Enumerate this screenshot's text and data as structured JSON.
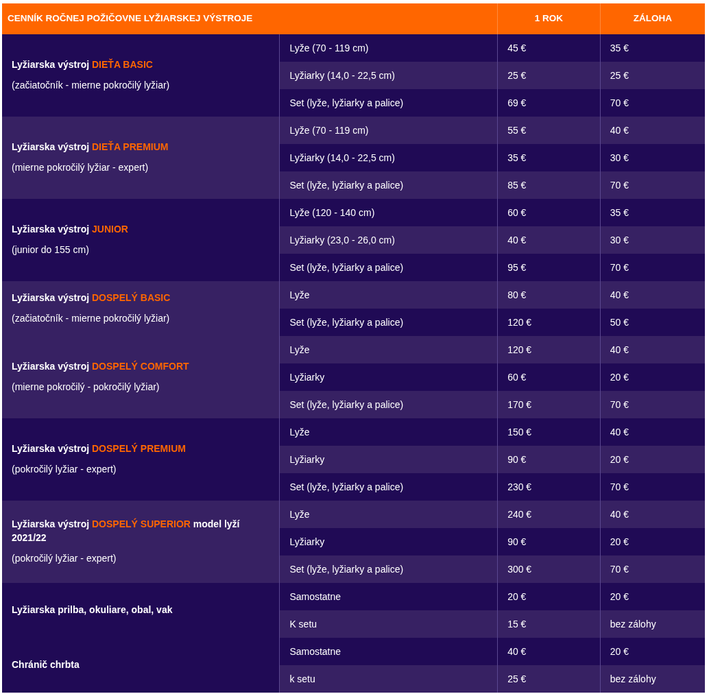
{
  "table": {
    "columns": [
      "CENNÍK ROČNEJ POŽIČOVNE LYŽIARSKEJ VÝSTROJE",
      "1 ROK",
      "ZÁLOHA"
    ],
    "groups": [
      {
        "title": [
          {
            "kind": "plain",
            "text": "Lyžiarska výstroj "
          },
          {
            "kind": "accent",
            "text": "DIEŤA BASIC"
          }
        ],
        "subtitle": "(začiatočník - mierne pokročilý lyžiar)",
        "items": [
          {
            "label": "Lyže (70 - 119 cm)",
            "price": "45 €",
            "deposit": "35 €"
          },
          {
            "label": "Lyžiarky (14,0 - 22,5 cm)",
            "price": "25 €",
            "deposit": "25 €"
          },
          {
            "label": "Set (lyže, lyžiarky a palice)",
            "price": "69 €",
            "deposit": "70 €"
          }
        ]
      },
      {
        "title": [
          {
            "kind": "plain",
            "text": "Lyžiarska výstroj "
          },
          {
            "kind": "accent",
            "text": "DIEŤA PREMIUM"
          }
        ],
        "subtitle": "(mierne pokročilý lyžiar - expert)",
        "items": [
          {
            "label": "Lyže (70 - 119 cm)",
            "price": "55 €",
            "deposit": "40 €"
          },
          {
            "label": "Lyžiarky (14,0 - 22,5 cm)",
            "price": "35 €",
            "deposit": "30 €"
          },
          {
            "label": "Set (lyže, lyžiarky a palice)",
            "price": "85 €",
            "deposit": "70 €"
          }
        ]
      },
      {
        "title": [
          {
            "kind": "plain",
            "text": "Lyžiarska výstroj "
          },
          {
            "kind": "accent",
            "text": "JUNIOR"
          }
        ],
        "subtitle": "(junior do 155 cm)",
        "items": [
          {
            "label": "Lyže (120 - 140 cm)",
            "price": "60 €",
            "deposit": "35 €"
          },
          {
            "label": "Lyžiarky (23,0 - 26,0 cm)",
            "price": "40 €",
            "deposit": "30 €"
          },
          {
            "label": "Set (lyže, lyžiarky a palice)",
            "price": "95 €",
            "deposit": "70 €"
          }
        ]
      },
      {
        "title": [
          {
            "kind": "plain",
            "text": "Lyžiarska výstroj "
          },
          {
            "kind": "accent",
            "text": "DOSPELÝ BASIC"
          }
        ],
        "subtitle": "(začiatočník - mierne pokročilý lyžiar)",
        "items": [
          {
            "label": "Lyže",
            "price": "80 €",
            "deposit": "40 €"
          },
          {
            "label": "Set (lyže, lyžiarky a palice)",
            "price": "120 €",
            "deposit": "50 €"
          }
        ]
      },
      {
        "title": [
          {
            "kind": "plain",
            "text": "Lyžiarska výstroj "
          },
          {
            "kind": "accent",
            "text": "DOSPELÝ COMFORT"
          }
        ],
        "subtitle": "(mierne pokročilý - pokročilý lyžiar)",
        "items": [
          {
            "label": "Lyže",
            "price": "120 €",
            "deposit": "40 €"
          },
          {
            "label": "Lyžiarky",
            "price": "60 €",
            "deposit": "20 €"
          },
          {
            "label": "Set (lyže, lyžiarky a palice)",
            "price": "170 €",
            "deposit": "70 €"
          }
        ]
      },
      {
        "title": [
          {
            "kind": "plain",
            "text": "Lyžiarska výstroj "
          },
          {
            "kind": "accent",
            "text": "DOSPELÝ PREMIUM"
          }
        ],
        "subtitle": "(pokročilý lyžiar - expert)",
        "items": [
          {
            "label": "Lyže",
            "price": "150 €",
            "deposit": "40 €"
          },
          {
            "label": "Lyžiarky",
            "price": "90 €",
            "deposit": "20 €"
          },
          {
            "label": "Set (lyže, lyžiarky a palice)",
            "price": "230 €",
            "deposit": "70 €"
          }
        ]
      },
      {
        "title": [
          {
            "kind": "plain",
            "text": "Lyžiarska výstroj "
          },
          {
            "kind": "accent",
            "text": "DOSPELÝ SUPERIOR"
          },
          {
            "kind": "plain",
            "text": " model lyží 2021/22"
          }
        ],
        "subtitle": "(pokročilý lyžiar - expert)",
        "items": [
          {
            "label": "Lyže",
            "price": "240 €",
            "deposit": "40 €"
          },
          {
            "label": "Lyžiarky",
            "price": "90 €",
            "deposit": "20 €"
          },
          {
            "label": "Set (lyže, lyžiarky a palice)",
            "price": "300 €",
            "deposit": "70 €"
          }
        ]
      },
      {
        "title": [
          {
            "kind": "plain",
            "text": "Lyžiarska prilba, okuliare, obal, vak"
          }
        ],
        "items": [
          {
            "label": "Samostatne",
            "price": "20 €",
            "deposit": "20 €"
          },
          {
            "label": "K setu",
            "price": "15 €",
            "deposit": "bez zálohy"
          }
        ]
      },
      {
        "title": [
          {
            "kind": "plain",
            "text": "Chránič chrbta"
          }
        ],
        "items": [
          {
            "label": "Samostatne",
            "price": "40 €",
            "deposit": "20 €"
          },
          {
            "label": "k setu",
            "price": "25 €",
            "deposit": "bez zálohy"
          }
        ]
      }
    ]
  }
}
